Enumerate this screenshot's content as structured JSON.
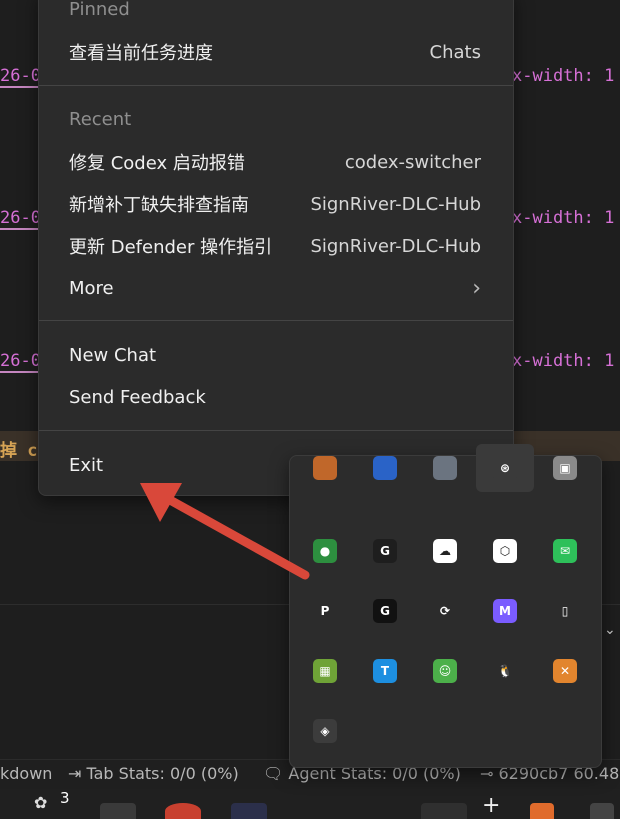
{
  "editor": {
    "code_fragment_left": "26-0",
    "code_fragment_right": "x-width: 1",
    "highlight_fragment": "掉 co"
  },
  "menu": {
    "pinned_header": "Pinned",
    "pinned_item": {
      "label": "查看当前任务进度",
      "context": "Chats"
    },
    "recent_header": "Recent",
    "recent_items": [
      {
        "label": "修复 Codex 启动报错",
        "context": "codex-switcher"
      },
      {
        "label": "新增补丁缺失排查指南",
        "context": "SignRiver-DLC-Hub"
      },
      {
        "label": "更新 Defender 操作指引",
        "context": "SignRiver-DLC-Hub"
      }
    ],
    "more_label": "More",
    "more_chevron": "›",
    "new_chat_label": "New Chat",
    "send_feedback_label": "Send Feedback",
    "exit_label": "Exit"
  },
  "statusbar": {
    "markdown_fragment": "kdown",
    "tab_stats": "Tab Stats: 0/0 (0%)",
    "agent_stats": "Agent Stats: 0/0 (0%)",
    "commit": "6290cb7 60.48"
  },
  "taskbar": {
    "badge_count": "3"
  },
  "tray": {
    "icons": [
      {
        "name": "app-orange-icon",
        "color": "#c0672a",
        "glyph": ""
      },
      {
        "name": "shield-blue-icon",
        "color": "#2a63c7",
        "glyph": ""
      },
      {
        "name": "disk-grey-icon",
        "color": "#6b7480",
        "glyph": ""
      },
      {
        "name": "openai-icon",
        "color": "#3a3a3a",
        "glyph": "⊛"
      },
      {
        "name": "box-grey-icon",
        "color": "#8a8a8a",
        "glyph": "▣"
      },
      {
        "name": "globe-green-icon",
        "color": "#2d8f3f",
        "glyph": "●"
      },
      {
        "name": "g-ring-icon",
        "color": "#1e1e1e",
        "glyph": "G"
      },
      {
        "name": "cloud-sync-icon",
        "color": "#ffffff",
        "glyph": "☁"
      },
      {
        "name": "cube-icon",
        "color": "#ffffff",
        "glyph": "⬡"
      },
      {
        "name": "wechat-icon",
        "color": "#2ec05a",
        "glyph": "✉"
      },
      {
        "name": "parsec-icon",
        "color": "#2c2c2c",
        "glyph": "P"
      },
      {
        "name": "logitech-g-icon",
        "color": "#111111",
        "glyph": "G"
      },
      {
        "name": "sync-square-icon",
        "color": "#2c2c2c",
        "glyph": "⟳"
      },
      {
        "name": "copilot-m365-icon",
        "color": "#7a5cff",
        "glyph": "M"
      },
      {
        "name": "usb-drive-icon",
        "color": "#2c2c2c",
        "glyph": "▯"
      },
      {
        "name": "grid-app-icon",
        "color": "#6fa337",
        "glyph": "▦"
      },
      {
        "name": "flag-blue-icon",
        "color": "#1d8fe0",
        "glyph": "T"
      },
      {
        "name": "cat-green-icon",
        "color": "#4cb04a",
        "glyph": "☺"
      },
      {
        "name": "qq-penguin-icon",
        "color": "#2c2c2c",
        "glyph": "🐧"
      },
      {
        "name": "x-circle-orange-icon",
        "color": "#e2852e",
        "glyph": "✕"
      },
      {
        "name": "unity-box-icon",
        "color": "#3c3c3c",
        "glyph": "◈"
      }
    ]
  },
  "colors": {
    "menu_bg": "#2b2b2b",
    "arrow": "#d9483a",
    "code_pink": "#d670d6"
  }
}
